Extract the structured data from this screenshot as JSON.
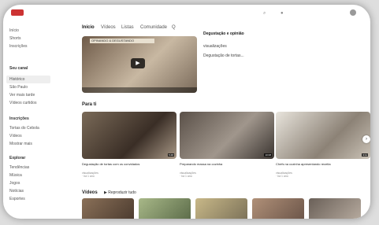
{
  "topbar": {
    "logo_icon": "youtube-logo-icon",
    "search_icon": "search-icon",
    "mic_icon": "mic-icon"
  },
  "sidebar": {
    "items": [
      "Início",
      "Shorts",
      "Inscrições",
      "Seu canal",
      "Histórico",
      "São Paulo",
      "Ver mais tarde",
      "Vídeos curtidos",
      "Inscrições",
      "Tortas do Cebola",
      "Vídeos",
      "Mostrar mais",
      "Explorar",
      "Tendências",
      "Música",
      "Jogos",
      "Notícias",
      "Esportes"
    ]
  },
  "tabs": [
    "Início",
    "Vídeos",
    "Listas",
    "Comunidade",
    "Q"
  ],
  "featured": {
    "banner": "OPINANDO & DEGUSTANDO",
    "title": "Degustação e opinião",
    "meta": "visualizações",
    "description": "Degustação de tortas..."
  },
  "sections": {
    "for_you": "Para ti",
    "videos": "Vídeos",
    "play_all": "▶ Reproduzir tudo"
  },
  "videos": [
    {
      "title": "Degustação de tortas com os convidados",
      "meta": "visualizações · há 1 ano",
      "duration": "5:48"
    },
    {
      "title": "Preparando massa na cozinha",
      "meta": "visualizações · há 1 ano",
      "duration": "10:08"
    },
    {
      "title": "Chefs na cozinha apresentando receita",
      "meta": "visualizações · há 1 ano",
      "duration": "3:11"
    }
  ]
}
